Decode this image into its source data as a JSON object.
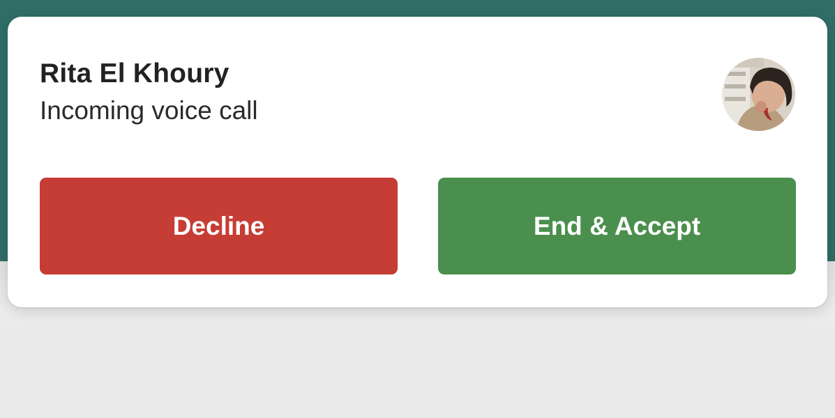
{
  "call": {
    "caller_name": "Rita El Khoury",
    "status": "Incoming voice call",
    "avatar_alt": "Rita El Khoury"
  },
  "actions": {
    "decline_label": "Decline",
    "accept_label": "End & Accept"
  },
  "colors": {
    "header": "#2f6d66",
    "decline": "#c53d35",
    "accept": "#4a8f4d",
    "card": "#ffffff",
    "background": "#e8e8e8"
  }
}
